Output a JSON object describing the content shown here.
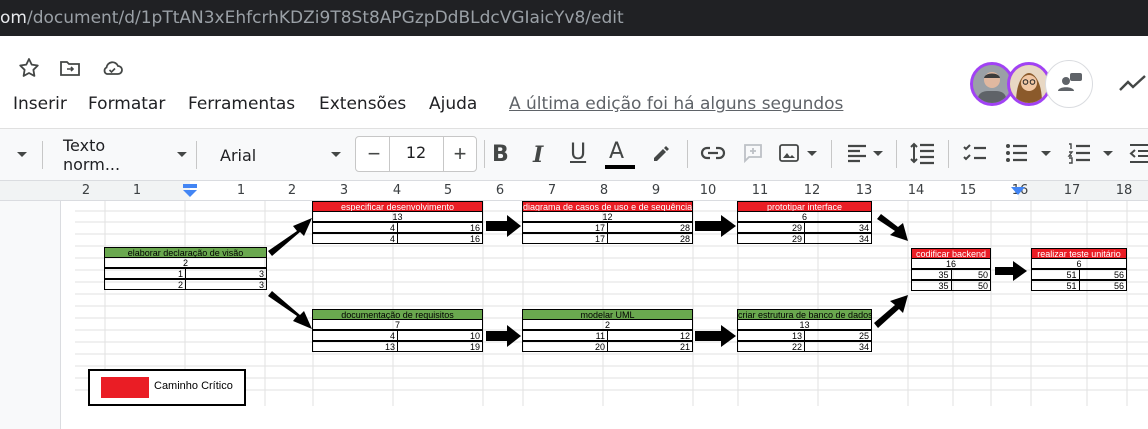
{
  "browser": {
    "url_host": "om",
    "url_path": "/document/d/1pTtAN3xEhfcrhKDZi9T8St8APGzpDdBLdcVGIaicYv8/edit"
  },
  "menu": {
    "items": [
      "Inserir",
      "Formatar",
      "Ferramentas",
      "Extensões",
      "Ajuda"
    ],
    "last_edit": "A última edição foi há alguns segundos"
  },
  "toolbar": {
    "style": "Texto norm...",
    "font": "Arial",
    "font_size": "12",
    "minus": "−",
    "plus": "+",
    "bold": "B",
    "italic": "I",
    "underline": "U",
    "text_color": "A"
  },
  "ruler": {
    "labels": [
      "2",
      "1",
      "1",
      "2",
      "3",
      "4",
      "5",
      "6",
      "7",
      "8",
      "9",
      "10",
      "11",
      "12",
      "13",
      "14",
      "15",
      "16",
      "17",
      "18"
    ]
  },
  "diagram": {
    "nodes": [
      {
        "title": "elaborar declaração de visão",
        "critical": false,
        "duration": "2",
        "es": "1",
        "ef": "3",
        "ls": "2",
        "lf": "3"
      },
      {
        "title": "especificar desenvolvimento",
        "critical": true,
        "duration": "13",
        "es": "4",
        "ef": "16",
        "ls": "4",
        "lf": "16"
      },
      {
        "title": "diagrama de casos de uso e de sequência",
        "critical": true,
        "duration": "12",
        "es": "17",
        "ef": "28",
        "ls": "17",
        "lf": "28"
      },
      {
        "title": "prototipar interface",
        "critical": true,
        "duration": "6",
        "es": "29",
        "ef": "34",
        "ls": "29",
        "lf": "34"
      },
      {
        "title": "documentação de requisitos",
        "critical": false,
        "duration": "7",
        "es": "4",
        "ef": "10",
        "ls": "13",
        "lf": "19"
      },
      {
        "title": "modelar UML",
        "critical": false,
        "duration": "2",
        "es": "11",
        "ef": "12",
        "ls": "20",
        "lf": "21"
      },
      {
        "title": "criar estrutura de banco de dados",
        "critical": false,
        "duration": "13",
        "es": "13",
        "ef": "25",
        "ls": "22",
        "lf": "34"
      },
      {
        "title": "codificar backend",
        "critical": true,
        "duration": "16",
        "es": "35",
        "ef": "50",
        "ls": "35",
        "lf": "50"
      },
      {
        "title": "realizar teste unitário",
        "critical": true,
        "duration": "6",
        "es": "51",
        "ef": "56",
        "ls": "51",
        "lf": "56"
      }
    ],
    "legend": "Caminho Crítico"
  },
  "colors": {
    "critical": "#ea1d25",
    "normal": "#6aa84f",
    "accent": "#4285f4"
  }
}
